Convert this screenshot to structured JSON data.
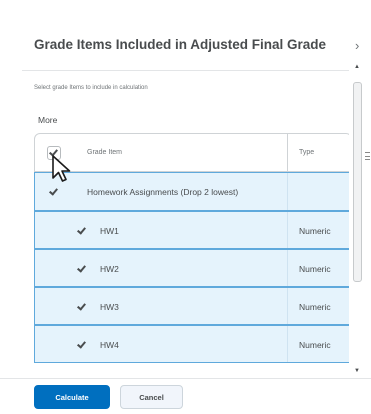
{
  "dialog": {
    "title": "Grade Items Included in Adjusted Final Grade",
    "close_glyph": "›"
  },
  "content": {
    "instructions": "Select grade Items to include in calculation",
    "more_label": "More"
  },
  "table": {
    "headers": {
      "grade_item": "Grade Item",
      "type": "Type"
    },
    "category": {
      "name": "Homework Assignments (Drop 2 lowest)",
      "checked": true
    },
    "rows": [
      {
        "name": "HW1",
        "type": "Numeric",
        "checked": true
      },
      {
        "name": "HW2",
        "type": "Numeric",
        "checked": true
      },
      {
        "name": "HW3",
        "type": "Numeric",
        "checked": true
      },
      {
        "name": "HW4",
        "type": "Numeric",
        "checked": true
      }
    ]
  },
  "footer": {
    "calculate_label": "Calculate",
    "cancel_label": "Cancel"
  },
  "colors": {
    "primary": "#006fbf",
    "selected_row": "#e5f3fc",
    "selected_border": "#5fa9dc"
  }
}
